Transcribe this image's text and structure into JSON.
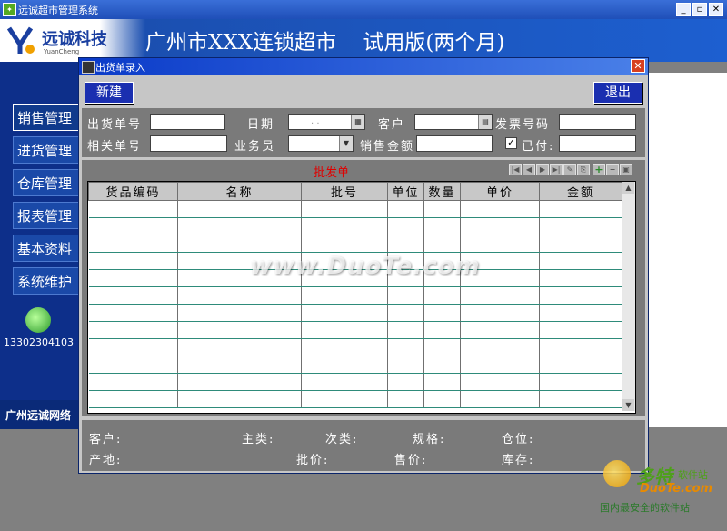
{
  "main_window": {
    "title": "远诚超市管理系统",
    "controls": {
      "minimize": "_",
      "maximize": "▫",
      "close": "✕"
    }
  },
  "banner": {
    "logo_text": "远诚科技",
    "logo_sub": "YuanCheng",
    "title": "广州市XXX连锁超市    试用版(两个月)"
  },
  "sidebar": {
    "items": [
      {
        "label": "销售管理"
      },
      {
        "label": "进货管理"
      },
      {
        "label": "仓库管理"
      },
      {
        "label": "报表管理"
      },
      {
        "label": "基本资料"
      },
      {
        "label": "系统维护"
      }
    ],
    "phone": "13302304103",
    "footer": "广州远诚网络"
  },
  "dialog": {
    "title": "出货单录入",
    "close_label": "✕",
    "new_button": "新建",
    "exit_button": "退出",
    "form": {
      "shipment_no_label": "出货单号",
      "date_label": "日期",
      "customer_label": "客户",
      "invoice_no_label": "发票号码",
      "related_no_label": "相关单号",
      "salesman_label": "业务员",
      "sales_amount_label": "销售金额",
      "paid_label": "已付:",
      "paid_checked": true,
      "date_value": ". .",
      "shipment_no_value": "",
      "customer_value": "",
      "invoice_no_value": "",
      "related_no_value": "",
      "salesman_value": "",
      "sales_amount_value": "",
      "paid_value": ""
    },
    "grid": {
      "caption": "批发单",
      "nav_buttons": [
        "first-icon",
        "prev-icon",
        "next-icon",
        "last-icon",
        "edit-icon",
        "copy-icon",
        "add-icon",
        "delete-icon",
        "save-icon"
      ],
      "columns": [
        "货品编码",
        "名称",
        "批号",
        "单位",
        "数量",
        "单价",
        "金额"
      ],
      "row_count": 12
    },
    "info": {
      "customer": "客户:",
      "main_category": "主类:",
      "sub_category": "次类:",
      "spec": "规格:",
      "location": "仓位:",
      "origin": "产地:",
      "wholesale_price": "批价:",
      "retail_price": "售价:",
      "stock": "库存:"
    }
  },
  "watermark": "www.DuoTe.com",
  "brand": {
    "name": "多特",
    "name_sub": "软件站",
    "domain": "DuoTe.com",
    "slogan": "国内最安全的软件站"
  }
}
